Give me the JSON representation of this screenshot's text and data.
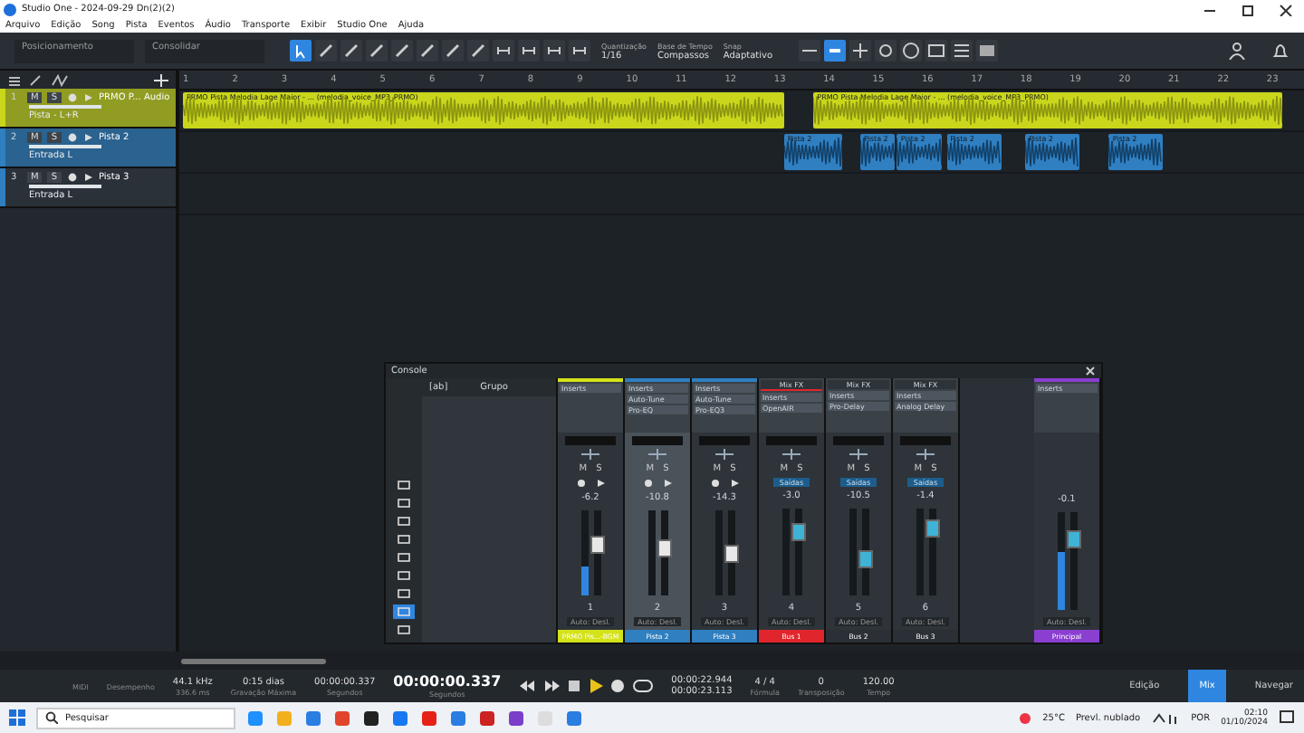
{
  "window": {
    "title": "Studio One - 2024-09-29 Dn(2)(2)"
  },
  "menu": [
    "Arquivo",
    "Edição",
    "Song",
    "Pista",
    "Eventos",
    "Áudio",
    "Transporte",
    "Exibir",
    "Studio One",
    "Ajuda"
  ],
  "toolbar": {
    "dropdowns": [
      "Posicionamento",
      "Consolidar"
    ],
    "settings": [
      {
        "label": "Quantização",
        "value": "1/16"
      },
      {
        "label": "Base de Tempo",
        "value": "Compassos"
      },
      {
        "label": "Snap",
        "value": "Adaptativo"
      }
    ]
  },
  "ruler": [
    "1",
    "2",
    "3",
    "4",
    "5",
    "6",
    "7",
    "8",
    "9",
    "10",
    "11",
    "12",
    "13",
    "14",
    "15",
    "16",
    "17",
    "18",
    "19",
    "20",
    "21",
    "22",
    "23"
  ],
  "tracks": [
    {
      "number": "1",
      "name": "PRMO P... Audio",
      "input": "Pista - L+R",
      "color": "#c9d61c",
      "selected": true,
      "buttons": [
        "M",
        "S"
      ],
      "events": [
        "PRMO Pista Melodia Lage Maior - ... (melodia_voice_MP3_PRMO)",
        "PRMO Pista Melodia Lage Maior - ... (melodia_voice_MP3_PRMO)"
      ]
    },
    {
      "number": "2",
      "name": "Pista 2",
      "input": "Entrada L",
      "color": "#2f7fc1",
      "selected": true,
      "buttons": [
        "M",
        "S"
      ],
      "events": [
        "Pista 2",
        "Pista 2",
        "Pista 2",
        "Pista 2",
        "Pista 2",
        "Pista 2"
      ]
    },
    {
      "number": "3",
      "name": "Pista 3",
      "input": "Entrada L",
      "color": "#2f7fc1",
      "selected": false,
      "buttons": [
        "M",
        "S"
      ]
    }
  ],
  "console": {
    "title": "Console",
    "group_tag": "[ab]",
    "group_header": "Grupo",
    "channels": [
      {
        "number": "1",
        "name": "PRMO Pis...-BGM",
        "color": "#d4e21a",
        "kind": "track",
        "selected": false,
        "inserts": [
          "Inserts"
        ],
        "buttons": [
          "M",
          "S"
        ],
        "volume": "-6.2",
        "level": 0.6,
        "meter": {
          "level": 0.35
        },
        "auto": "Auto: Desl."
      },
      {
        "number": "2",
        "name": "Pista 2",
        "color": "#2f7fc1",
        "kind": "track",
        "selected": true,
        "inserts": [
          "Inserts",
          "Auto-Tune",
          "Pro-EQ"
        ],
        "buttons": [
          "M",
          "S"
        ],
        "volume": "-10.8",
        "level": 0.55,
        "auto": "Auto: Desl."
      },
      {
        "number": "3",
        "name": "Pista 3",
        "color": "#2f7fc1",
        "kind": "track",
        "selected": false,
        "inserts": [
          "Inserts",
          "Auto-Tune",
          "Pro-EQ3"
        ],
        "buttons": [
          "M",
          "S"
        ],
        "volume": "-14.3",
        "level": 0.48,
        "auto": "Auto: Desl."
      },
      {
        "number": "4",
        "name": "Bus 1",
        "color": "#e0262c",
        "kind": "bus",
        "selected": false,
        "inserts": [
          "Mix FX",
          "Inserts",
          "OpenAIR"
        ],
        "buttons": [
          "M",
          "S"
        ],
        "output": "Saídas",
        "volume": "-3.0",
        "level": 0.72,
        "auto": "Auto: Desl."
      },
      {
        "number": "5",
        "name": "Bus 2",
        "kind": "bus",
        "selected": false,
        "inserts": [
          "Mix FX",
          "Inserts",
          "Pro-Delay"
        ],
        "buttons": [
          "M",
          "S"
        ],
        "output": "Saídas",
        "volume": "-10.5",
        "level": 0.42,
        "auto": "Auto: Desl."
      },
      {
        "number": "6",
        "name": "Bus 3",
        "kind": "bus",
        "selected": false,
        "inserts": [
          "Mix FX",
          "Inserts",
          "Analog Delay"
        ],
        "buttons": [
          "M",
          "S"
        ],
        "output": "Saídas",
        "volume": "-1.4",
        "level": 0.78,
        "auto": "Auto: Desl."
      }
    ],
    "master": {
      "name": "Principal",
      "color": "#8a3fd1",
      "inserts": [
        "Inserts"
      ],
      "volume": "-0.1",
      "level": 0.72,
      "meter": {
        "level": 0.6
      },
      "auto": "Auto: Desl."
    }
  },
  "transport": {
    "items": [
      {
        "label": "MIDI"
      },
      {
        "label": "Desempenho"
      },
      {
        "value": "44.1 kHz",
        "label": "336.6 ms"
      },
      {
        "value": "0:15 dias",
        "label": "Gravação Máxima"
      },
      {
        "value": "00:00:00.337",
        "label": "Segundos"
      }
    ],
    "time": "00:00:00.337",
    "time_label": "Segundos",
    "loop_start": "00:00:22.944",
    "loop_end": "00:00:23.113",
    "right": [
      {
        "value": "4 / 4",
        "label": "Fórmula"
      },
      {
        "value": "0",
        "label": "Transposição"
      },
      {
        "value": "120.00",
        "label": "Tempo"
      }
    ],
    "views": [
      {
        "label": "Edição",
        "selected": false
      },
      {
        "label": "Mix",
        "selected": true
      },
      {
        "label": "Navegar",
        "selected": false
      }
    ]
  },
  "taskbar": {
    "search": "Pesquisar",
    "temp": "25°C",
    "weather": "Prevl. nublado",
    "lang": "POR",
    "time": "02:10",
    "date": "01/10/2024"
  }
}
